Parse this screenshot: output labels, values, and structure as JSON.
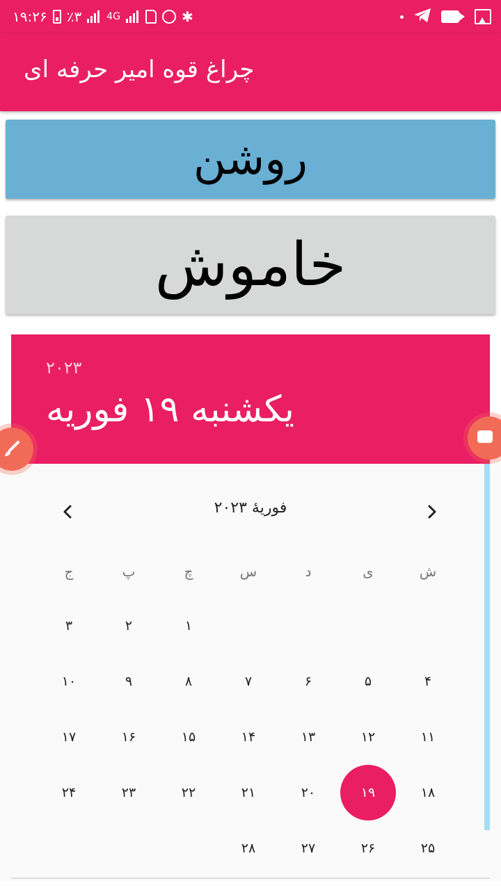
{
  "status_bar": {
    "time": "۱۹:۲۶",
    "battery": "٪۳",
    "network": "4G",
    "bluetooth_glyph": "✱"
  },
  "app_bar": {
    "title": "چراغ قوه امیر حرفه ای"
  },
  "buttons": {
    "on_label": "روشن",
    "off_label": "خاموش"
  },
  "date_picker": {
    "year": "۲۰۲۳",
    "selected_date": "یکشنبه ۱۹ فوریه",
    "month_label": "فوریهٔ ۲۰۲۳",
    "weekdays": [
      "ش",
      "ی",
      "د",
      "س",
      "چ",
      "پ",
      "ج"
    ],
    "weeks": [
      [
        "",
        "",
        "",
        "",
        "۱",
        "۲",
        "۳"
      ],
      [
        "۴",
        "۵",
        "۶",
        "۷",
        "۸",
        "۹",
        "۱۰"
      ],
      [
        "۱۱",
        "۱۲",
        "۱۳",
        "۱۴",
        "۱۵",
        "۱۶",
        "۱۷"
      ],
      [
        "۱۸",
        "۱۹",
        "۲۰",
        "۲۱",
        "۲۲",
        "۲۳",
        "۲۴"
      ],
      [
        "۲۵",
        "۲۶",
        "۲۷",
        "۲۸",
        "",
        "",
        ""
      ]
    ],
    "selected_day": "۱۹"
  },
  "colors": {
    "accent": "#e91e63",
    "on_button": "#6ab0d4",
    "off_button": "#d7d8d8",
    "overlay_bubble": "#f26b57"
  },
  "icons": {
    "prev_month": "chevron-left-icon",
    "next_month": "chevron-right-icon",
    "overlay_left": "brush-icon",
    "overlay_right": "video-camera-icon"
  }
}
